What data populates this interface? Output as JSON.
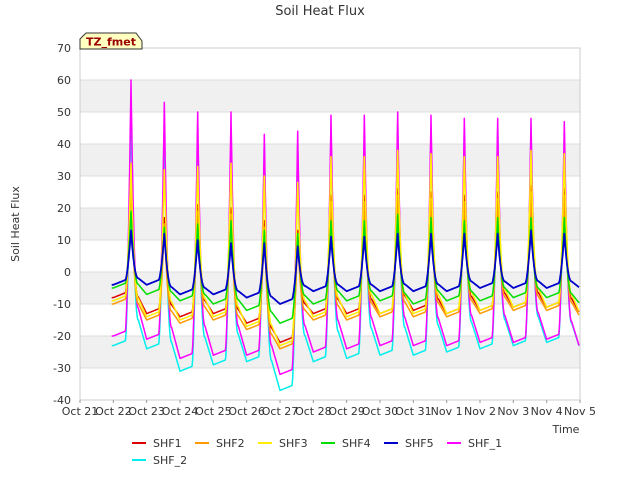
{
  "chart_data": {
    "type": "line",
    "title": "Soil Heat Flux",
    "xlabel": "Time",
    "ylabel": "Soil Heat Flux",
    "badge": "TZ_fmet",
    "ylim": [
      -40,
      70
    ],
    "yticks": [
      -40,
      -30,
      -20,
      -10,
      0,
      10,
      20,
      30,
      40,
      50,
      60,
      70
    ],
    "xticks": [
      "Oct 21",
      "Oct 22",
      "Oct 23",
      "Oct 24",
      "Oct 25",
      "Oct 26",
      "Oct 27",
      "Oct 28",
      "Oct 29",
      "Oct 30",
      "Oct 31",
      "Nov 1",
      "Nov 2",
      "Nov 3",
      "Nov 4",
      "Nov 5"
    ],
    "grid": true,
    "legend_position": "bottom",
    "x_start_date": "Oct 21",
    "x_end_date": "Nov 5",
    "days": [
      "Oct 22",
      "Oct 23",
      "Oct 24",
      "Oct 25",
      "Oct 26",
      "Oct 27",
      "Oct 28",
      "Oct 29",
      "Oct 30",
      "Oct 31",
      "Nov 1",
      "Nov 2",
      "Nov 3",
      "Nov 4"
    ],
    "series": [
      {
        "name": "SHF1",
        "color": "#dd0000",
        "peaks": [
          30,
          17,
          21,
          20,
          16,
          13,
          24,
          24,
          26,
          25,
          24,
          25,
          27,
          26
        ],
        "troughs": [
          -8,
          -13,
          -14,
          -13,
          -16,
          -22,
          -13,
          -13,
          -13,
          -12,
          -13,
          -12,
          -11,
          -11,
          -13
        ]
      },
      {
        "name": "SHF2",
        "color": "#ff9900",
        "peaks": [
          28,
          15,
          19,
          18,
          14,
          11,
          22,
          22,
          24,
          23,
          22,
          23,
          25,
          24
        ],
        "troughs": [
          -10,
          -15,
          -16,
          -15,
          -18,
          -24,
          -15,
          -15,
          -14,
          -14,
          -14,
          -13,
          -12,
          -12,
          -14
        ]
      },
      {
        "name": "SHF3",
        "color": "#ffee00",
        "peaks": [
          34,
          32,
          33,
          34,
          30,
          28,
          36,
          36,
          38,
          37,
          36,
          36,
          38,
          37
        ],
        "troughs": [
          -9,
          -14,
          -15,
          -14,
          -17,
          -23,
          -14,
          -14,
          -13,
          -13,
          -13,
          -12,
          -11,
          -11,
          -13
        ]
      },
      {
        "name": "SHF4",
        "color": "#00dd00",
        "peaks": [
          19,
          14,
          15,
          16,
          13,
          12,
          16,
          16,
          18,
          17,
          16,
          17,
          17,
          17
        ],
        "troughs": [
          -5,
          -7,
          -9,
          -10,
          -12,
          -16,
          -10,
          -9,
          -9,
          -10,
          -9,
          -9,
          -8,
          -8,
          -10
        ]
      },
      {
        "name": "SHF5",
        "color": "#0000cc",
        "peaks": [
          13,
          12,
          10,
          9,
          9,
          8,
          11,
          11,
          12,
          12,
          12,
          12,
          13,
          12
        ],
        "troughs": [
          -4,
          -4,
          -7,
          -7,
          -8,
          -10,
          -6,
          -6,
          -6,
          -6,
          -6,
          -5,
          -5,
          -5,
          -5
        ]
      },
      {
        "name": "SHF_1",
        "color": "#ff00ff",
        "peaks": [
          60,
          53,
          50,
          50,
          43,
          44,
          49,
          49,
          50,
          49,
          48,
          48,
          48,
          47
        ],
        "troughs": [
          -20,
          -21,
          -27,
          -26,
          -26,
          -32,
          -25,
          -24,
          -23,
          -23,
          -23,
          -22,
          -22,
          -21,
          -24
        ]
      },
      {
        "name": "SHF_2",
        "color": "#00eeee",
        "peaks": [
          51,
          44,
          42,
          43,
          40,
          40,
          43,
          43,
          46,
          45,
          45,
          45,
          45,
          43
        ],
        "troughs": [
          -23,
          -24,
          -31,
          -29,
          -28,
          -37,
          -28,
          -27,
          -26,
          -26,
          -25,
          -24,
          -23,
          -22,
          -24
        ]
      }
    ]
  }
}
